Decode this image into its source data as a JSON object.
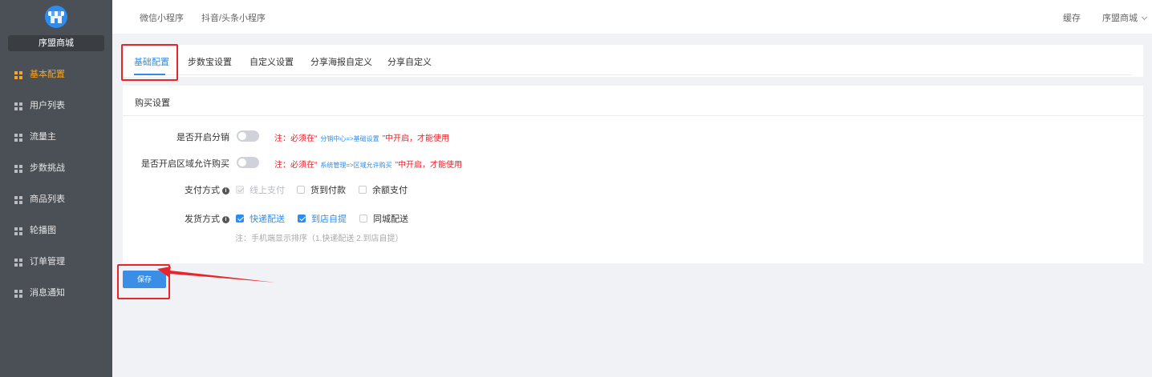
{
  "sidebar": {
    "store_name": "序盟商城",
    "items": [
      {
        "label": "基本配置",
        "active": true
      },
      {
        "label": "用户列表"
      },
      {
        "label": "流量主"
      },
      {
        "label": "步数挑战"
      },
      {
        "label": "商品列表"
      },
      {
        "label": "轮播图"
      },
      {
        "label": "订单管理"
      },
      {
        "label": "消息通知"
      }
    ]
  },
  "topbar": {
    "tabs": [
      "微信小程序",
      "抖音/头条小程序"
    ],
    "cache_label": "缓存",
    "user_label": "序盟商城"
  },
  "tabs": [
    "基础配置",
    "步数宝设置",
    "自定义设置",
    "分享海报自定义",
    "分享自定义"
  ],
  "card": {
    "title": "购买设置",
    "distribution": {
      "label": "是否开启分销",
      "note_prefix": "注：必须在“",
      "note_path": "分销中心=>基础设置",
      "note_suffix": "”中开启，才能使用"
    },
    "region": {
      "label": "是否开启区域允许购买",
      "note_prefix": "注：必须在“",
      "note_path": "系统管理=>区域允许购买",
      "note_suffix": "”中开启，才能使用"
    },
    "payment": {
      "label": "支付方式",
      "options": [
        "线上支付",
        "货到付款",
        "余额支付"
      ]
    },
    "delivery": {
      "label": "发货方式",
      "options": [
        "快递配送",
        "到店自提",
        "同城配送"
      ],
      "note": "注：手机端显示排序（1.快递配送 2.到店自提）"
    }
  },
  "save_label": "保存",
  "colors": {
    "sidebar_bg": "#4b4f56",
    "accent": "#2d8cf0",
    "active_nav": "#f5a623",
    "warning": "#ed1c24",
    "annotation": "#e8262a"
  }
}
